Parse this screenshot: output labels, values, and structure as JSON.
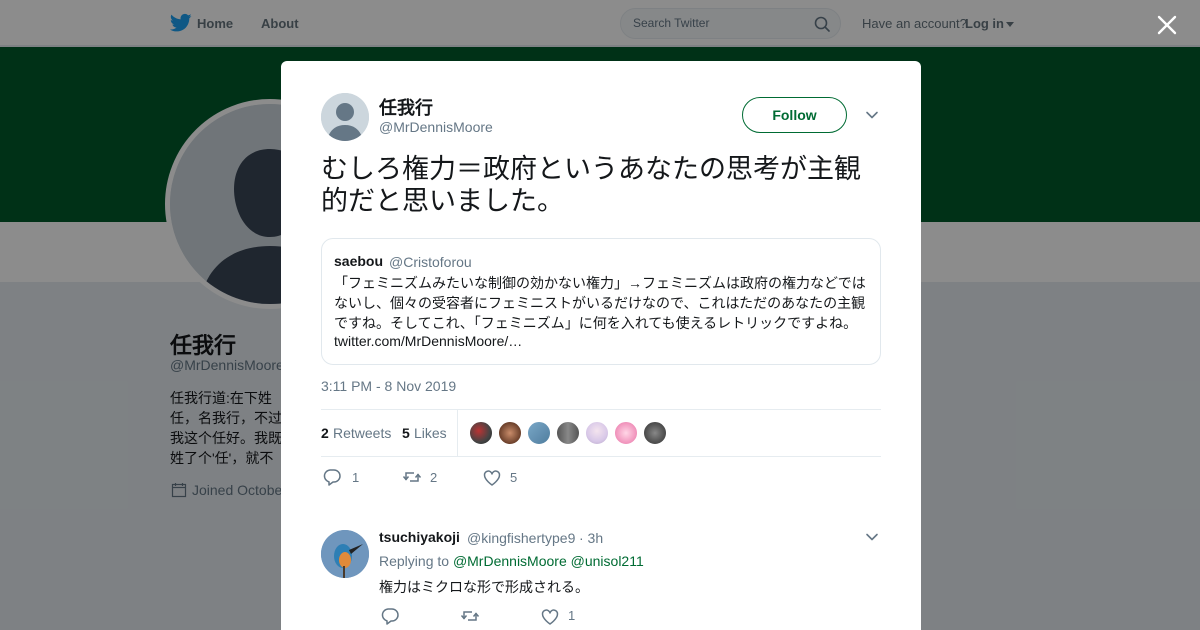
{
  "nav": {
    "home": "Home",
    "about": "About",
    "search_placeholder": "Search Twitter",
    "account_question": "Have an account?",
    "login": "Log in"
  },
  "profile": {
    "name": "任我行",
    "handle": "@MrDennisMoore",
    "bio": "任我行道:在下姓任，名我行，不过我这个任好。我既姓了个'任'，就不能叫'任你行'，叫做'我行'，只好任我行了。我想去哪里，就走到哪里",
    "joined": "Joined October"
  },
  "tweet": {
    "author_name": "任我行",
    "author_handle": "@MrDennisMoore",
    "follow_label": "Follow",
    "text": "むしろ権力＝政府というあなたの思考が主観的だと思いました。",
    "timestamp": "3:11 PM - 8 Nov 2019",
    "quote": {
      "name": "saebou",
      "handle": "@Cristoforou",
      "text": "「フェミニズムみたいな制御の効かない権力」→フェミニズムは政府の権力などではないし、個々の受容者にフェミニストがいるだけなので、これはただのあなたの主観ですね。そしてこれ、「フェミニズム」に何を入れても使えるレトリックですよね。",
      "link": "twitter.com/MrDennisMoore/…"
    },
    "stats": {
      "retweets_count": "2",
      "retweets_label": "Retweets",
      "likes_count": "5",
      "likes_label": "Likes"
    },
    "actions": {
      "reply_count": "1",
      "retweet_count": "2",
      "like_count": "5"
    }
  },
  "reply": {
    "name": "tsuchiyakoji",
    "handle": "@kingfishertype9",
    "time": "· 3h",
    "replying_to_label": "Replying to",
    "mention1": "@MrDennisMoore",
    "mention2": "@unisol211",
    "text": "権力はミクロな形で形成される。",
    "like_count": "1"
  },
  "colors": {
    "brand_green": "#006b33",
    "banner_green": "#005a2b",
    "twitter_blue": "#1da1f2"
  },
  "icons": [
    "twitter-bird-icon",
    "search-icon",
    "caret-down-icon",
    "close-icon",
    "chevron-down-icon",
    "reply-icon",
    "retweet-icon",
    "heart-icon",
    "calendar-icon"
  ]
}
